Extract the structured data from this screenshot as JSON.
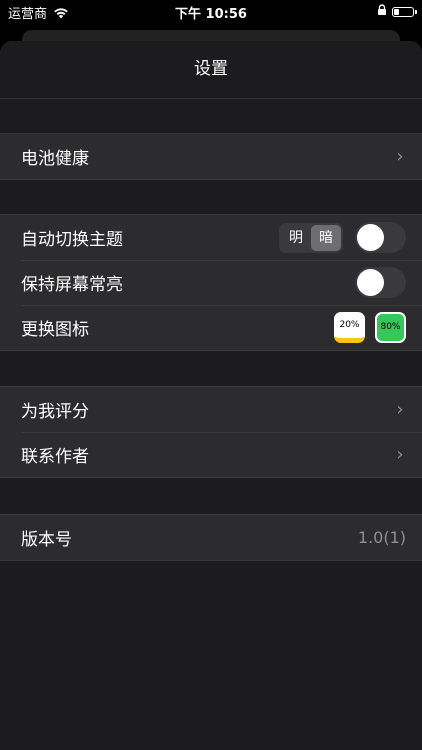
{
  "status_bar": {
    "carrier": "运营商",
    "time": "下午 10:56",
    "battery_level": 0.25
  },
  "nav": {
    "title": "设置"
  },
  "groups": {
    "battery": {
      "health_label": "电池健康"
    },
    "display": {
      "auto_theme_label": "自动切换主题",
      "theme_light": "明",
      "theme_dark": "暗",
      "theme_selected": "暗",
      "auto_theme_enabled": false,
      "keep_awake_label": "保持屏幕常亮",
      "keep_awake_enabled": false,
      "change_icon_label": "更换图标",
      "icon_options": [
        "20%",
        "80%"
      ]
    },
    "about": {
      "rate_label": "为我评分",
      "contact_label": "联系作者"
    },
    "version": {
      "label": "版本号",
      "value": "1.0(1)"
    }
  },
  "colors": {
    "background": "#1c1c1e",
    "cell": "#2c2c2e",
    "icon_yellow": "#f5c518",
    "icon_green": "#34c759"
  }
}
